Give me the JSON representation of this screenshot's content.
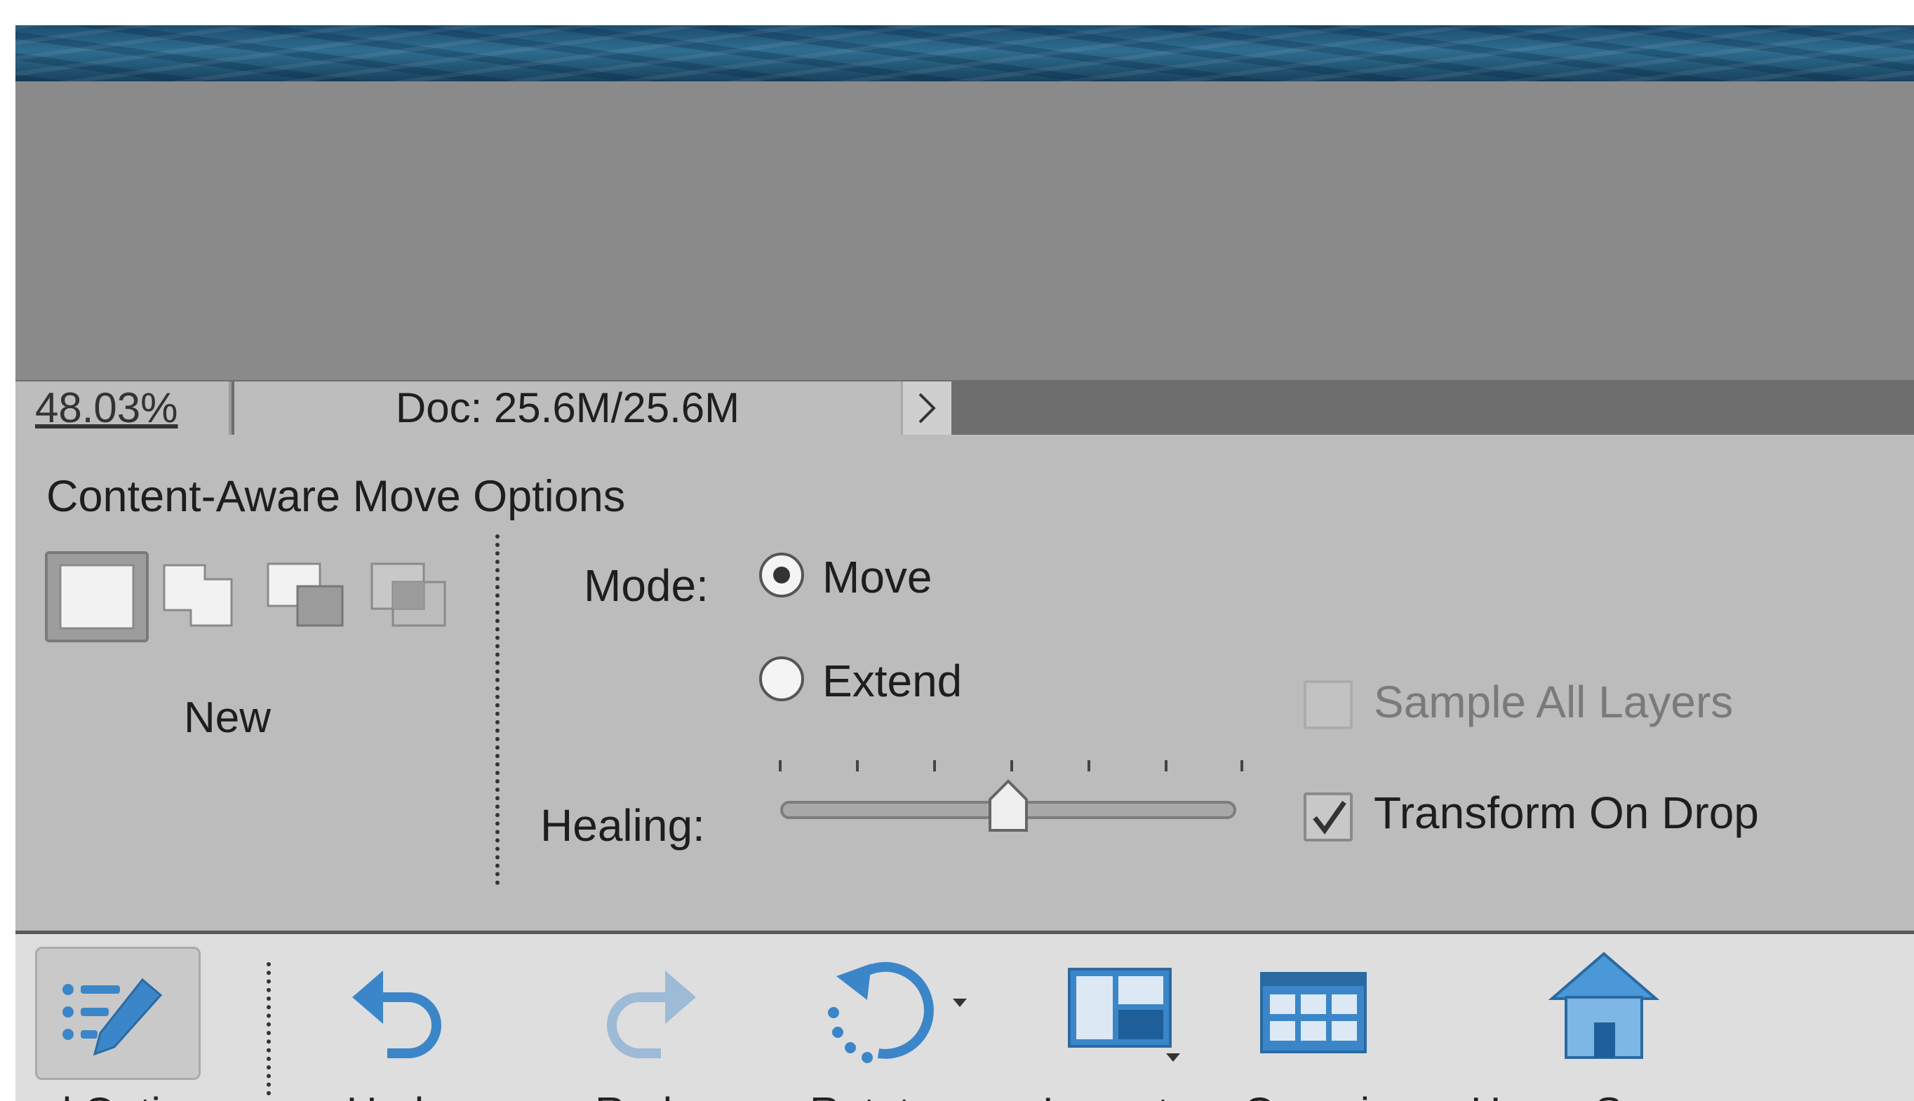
{
  "status_bar": {
    "zoom": "48.03%",
    "doc_info": "Doc: 25.6M/25.6M"
  },
  "options_panel": {
    "title": "Content-Aware Move Options",
    "selection_mode_label": "New",
    "mode_label": "Mode:",
    "mode_options": [
      {
        "label": "Move",
        "selected": true
      },
      {
        "label": "Extend",
        "selected": false
      }
    ],
    "healing_label": "Healing:",
    "healing_value": 3,
    "healing_range": [
      0,
      6
    ],
    "sample_all_layers": {
      "label": "Sample All Layers",
      "checked": false,
      "enabled": false
    },
    "transform_on_drop": {
      "label": "Transform On Drop",
      "checked": true,
      "enabled": true
    }
  },
  "taskbar": {
    "items": [
      {
        "label": "ool Options",
        "icon": "tool-options-icon"
      },
      {
        "label": "Undo",
        "icon": "undo-icon"
      },
      {
        "label": "Redo",
        "icon": "redo-icon"
      },
      {
        "label": "Rotate",
        "icon": "rotate-icon"
      },
      {
        "label": "Layout",
        "icon": "layout-icon"
      },
      {
        "label": "Organizer",
        "icon": "organizer-icon"
      },
      {
        "label": "Home Screen",
        "icon": "home-icon"
      }
    ]
  },
  "colors": {
    "accent_blue": "#3b86c8",
    "panel_bg": "#bcbcbc",
    "taskbar_bg": "#dedede"
  }
}
